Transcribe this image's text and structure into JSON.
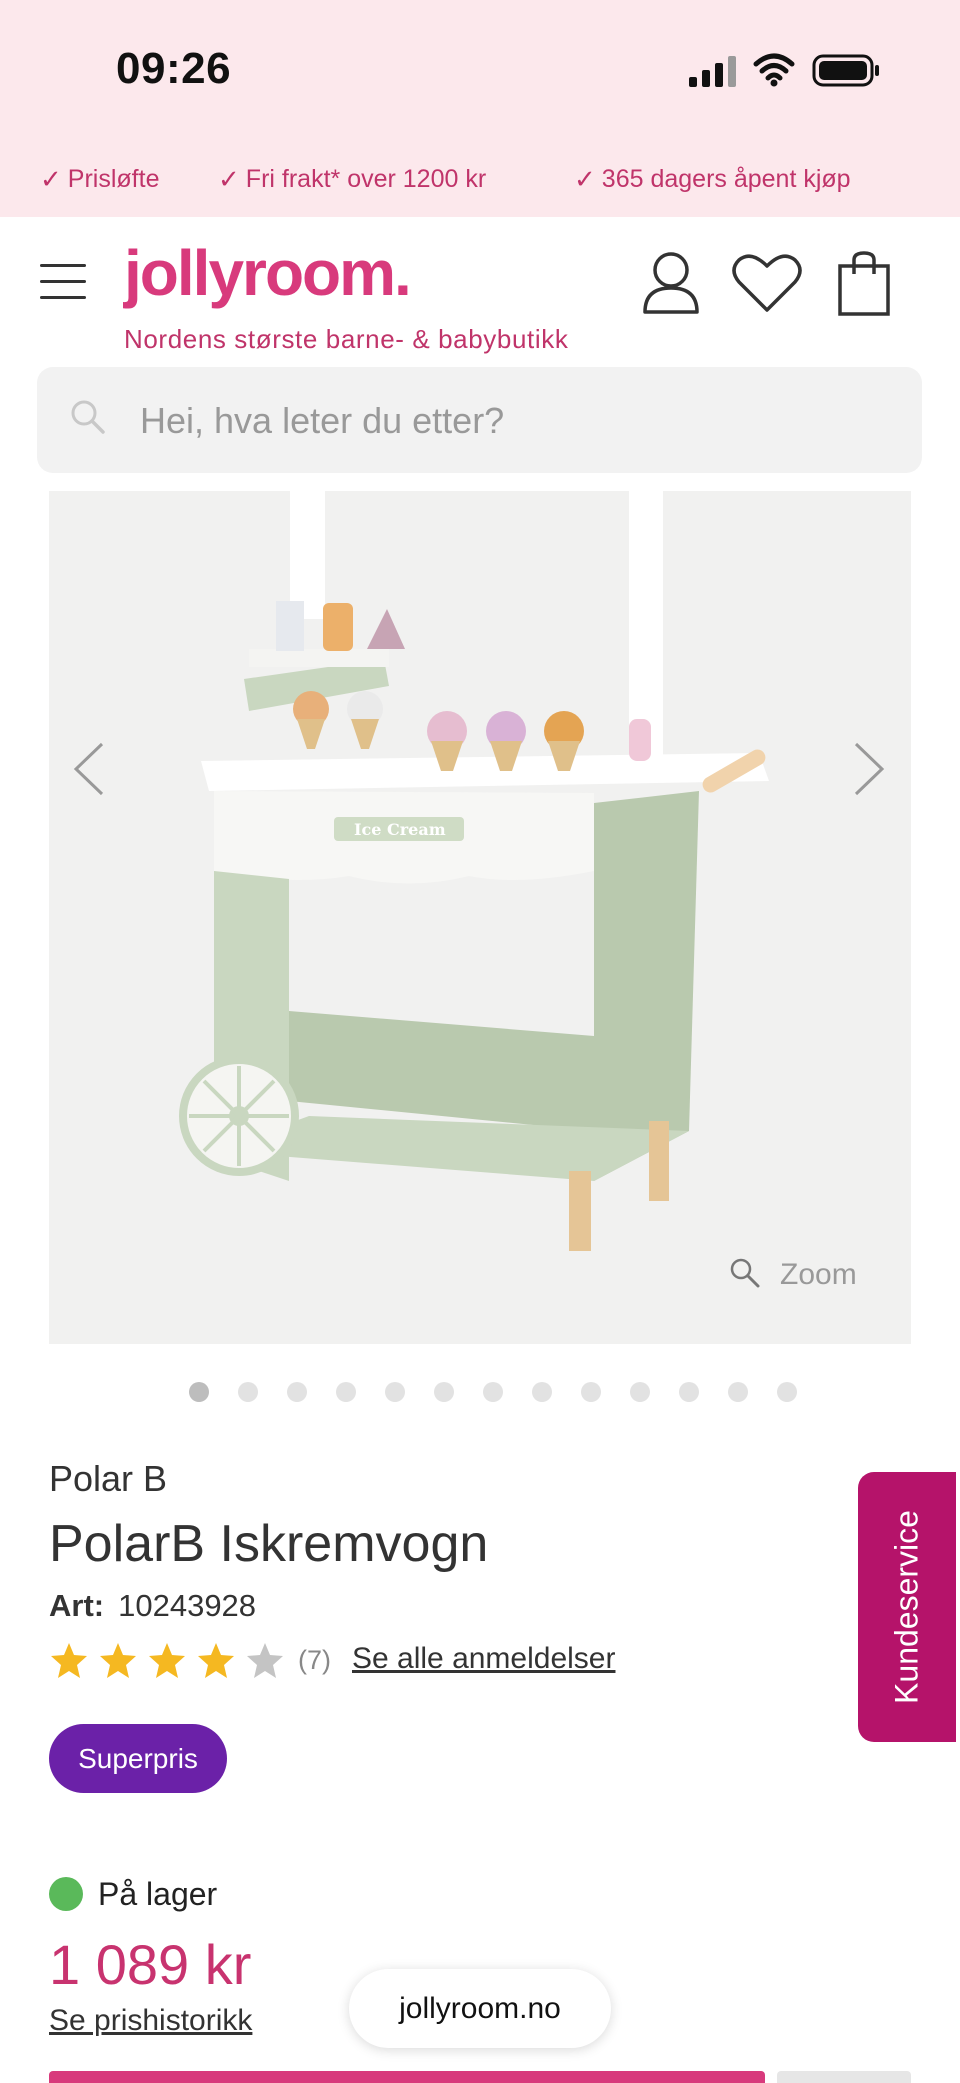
{
  "status_bar": {
    "time": "09:26"
  },
  "usp": [
    {
      "check": "✓",
      "label": "Prisløfte"
    },
    {
      "check": "✓",
      "label": "Fri frakt* over 1200 kr"
    },
    {
      "check": "✓",
      "label": "365 dagers åpent kjøp"
    }
  ],
  "header": {
    "logo": "jollyroom.",
    "tagline": "Nordens største barne- & babybutikk"
  },
  "search": {
    "placeholder": "Hei, hva leter du etter?"
  },
  "gallery": {
    "zoom_label": "Zoom",
    "slide_count": 13,
    "active_index": 0,
    "image_text": "Ice Cream"
  },
  "product": {
    "brand": "Polar B",
    "title": "PolarB Iskremvogn",
    "art_label": "Art:",
    "art_number": "10243928",
    "rating": 4,
    "rating_count": "(7)",
    "reviews_link": "Se alle anmeldelser",
    "badge": "Superpris",
    "stock": "På lager",
    "price": "1 089 kr",
    "price_history_link": "Se prishistorikk"
  },
  "side_tab": {
    "label": "Kundeservice"
  },
  "browser": {
    "url": "jollyroom.no"
  },
  "colors": {
    "brand_pink": "#d83a7c",
    "badge_purple": "#6b21a8",
    "stock_green": "#5ab95a",
    "side_tab": "#b5136a",
    "star": "#f5b821"
  }
}
